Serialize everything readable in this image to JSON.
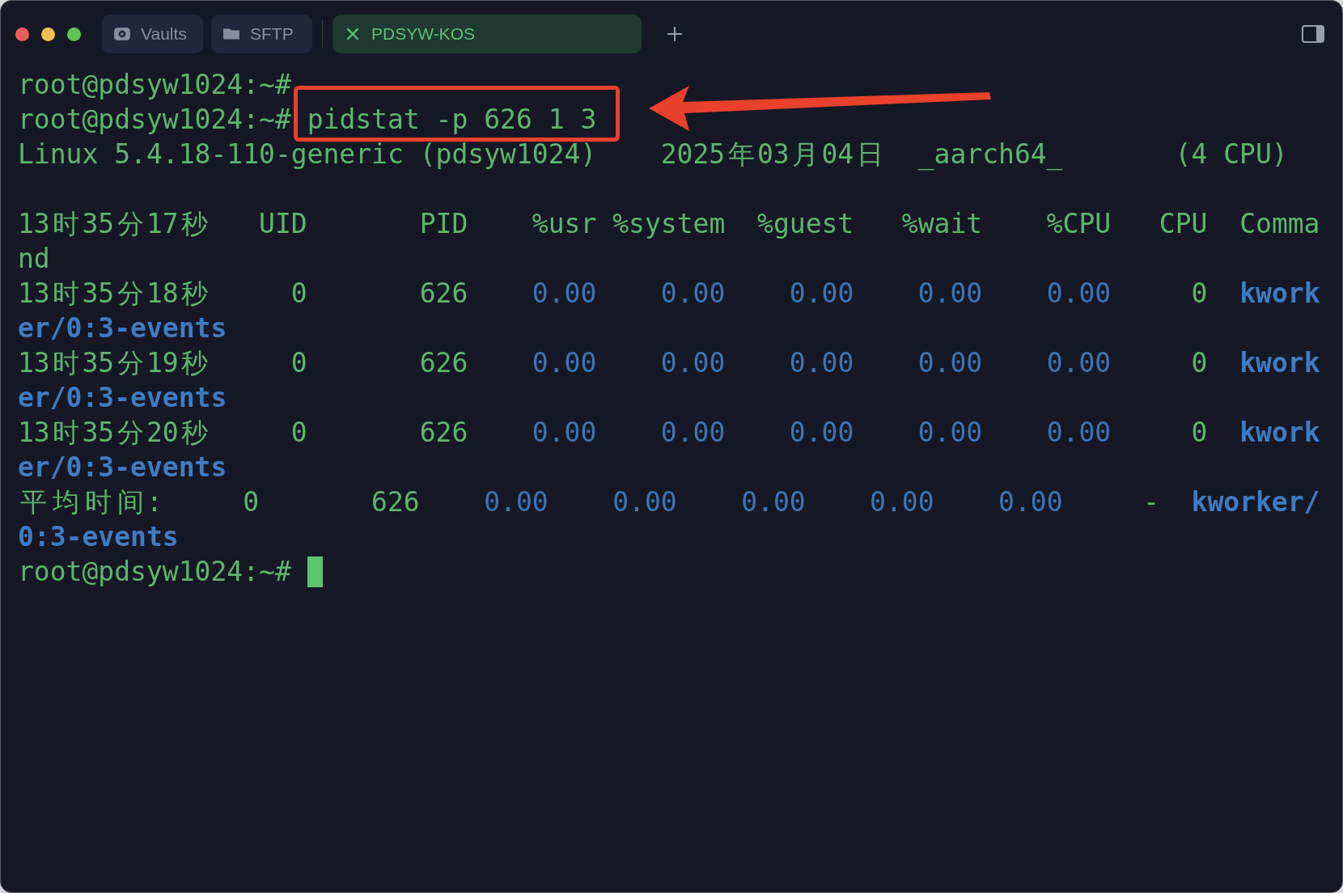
{
  "tabs": [
    {
      "label": "Vaults",
      "kind": "vault",
      "selected": false
    },
    {
      "label": "SFTP",
      "kind": "folder",
      "selected": false
    },
    {
      "label": "PDSYW-KOS",
      "kind": "session",
      "selected": true
    }
  ],
  "terminal": {
    "lines": [
      {
        "kind": "text",
        "segments": [
          {
            "text": "root@pdsyw1024:~#",
            "kind": "text"
          }
        ]
      },
      {
        "kind": "text",
        "segments": [
          {
            "text": "root@pdsyw1024:~#",
            "kind": "text"
          },
          {
            "text": " pidstat -p 626 1 3",
            "kind": "command"
          }
        ]
      },
      {
        "kind": "text",
        "segments": [
          {
            "text": "Linux 5.4.18-110-generic (pdsyw1024)",
            "kind": "text"
          },
          {
            "text": "    2025年03月04日",
            "kind": "text"
          },
          {
            "text": "  _aarch64_",
            "kind": "text"
          },
          {
            "text": "       (4 CPU)",
            "kind": "text"
          }
        ]
      },
      {
        "kind": "blank"
      },
      {
        "kind": "text",
        "segments": [
          {
            "text": "13时35分17秒",
            "kind": "text"
          },
          {
            "text": "   UID",
            "kind": "text"
          },
          {
            "text": "       PID",
            "kind": "text"
          },
          {
            "text": "    %usr",
            "kind": "text"
          },
          {
            "text": " %system",
            "kind": "text"
          },
          {
            "text": "  %guest",
            "kind": "text"
          },
          {
            "text": "   %wait",
            "kind": "text"
          },
          {
            "text": "    %CPU",
            "kind": "text"
          },
          {
            "text": "   CPU",
            "kind": "text"
          },
          {
            "text": "  Comma",
            "kind": "text"
          }
        ]
      },
      {
        "kind": "text",
        "segments": [
          {
            "text": "nd",
            "kind": "text"
          }
        ]
      },
      {
        "kind": "text",
        "segments": [
          {
            "text": "13时35分18秒",
            "kind": "text"
          },
          {
            "text": "     0",
            "kind": "text"
          },
          {
            "text": "       626",
            "kind": "text"
          },
          {
            "text": "    0.00",
            "kind": "number"
          },
          {
            "text": "    0.00",
            "kind": "number"
          },
          {
            "text": "    0.00",
            "kind": "number"
          },
          {
            "text": "    0.00",
            "kind": "number"
          },
          {
            "text": "    0.00",
            "kind": "number"
          },
          {
            "text": "     0",
            "kind": "text"
          },
          {
            "text": "  kwork",
            "kind": "process"
          }
        ]
      },
      {
        "kind": "text",
        "segments": [
          {
            "text": "er/0:3-events",
            "kind": "process"
          }
        ]
      },
      {
        "kind": "text",
        "segments": [
          {
            "text": "13时35分19秒",
            "kind": "text"
          },
          {
            "text": "     0",
            "kind": "text"
          },
          {
            "text": "       626",
            "kind": "text"
          },
          {
            "text": "    0.00",
            "kind": "number"
          },
          {
            "text": "    0.00",
            "kind": "number"
          },
          {
            "text": "    0.00",
            "kind": "number"
          },
          {
            "text": "    0.00",
            "kind": "number"
          },
          {
            "text": "    0.00",
            "kind": "number"
          },
          {
            "text": "     0",
            "kind": "text"
          },
          {
            "text": "  kwork",
            "kind": "process"
          }
        ]
      },
      {
        "kind": "text",
        "segments": [
          {
            "text": "er/0:3-events",
            "kind": "process"
          }
        ]
      },
      {
        "kind": "text",
        "segments": [
          {
            "text": "13时35分20秒",
            "kind": "text"
          },
          {
            "text": "     0",
            "kind": "text"
          },
          {
            "text": "       626",
            "kind": "text"
          },
          {
            "text": "    0.00",
            "kind": "number"
          },
          {
            "text": "    0.00",
            "kind": "number"
          },
          {
            "text": "    0.00",
            "kind": "number"
          },
          {
            "text": "    0.00",
            "kind": "number"
          },
          {
            "text": "    0.00",
            "kind": "number"
          },
          {
            "text": "     0",
            "kind": "text"
          },
          {
            "text": "  kwork",
            "kind": "process"
          }
        ]
      },
      {
        "kind": "text",
        "segments": [
          {
            "text": "er/0:3-events",
            "kind": "process"
          }
        ]
      },
      {
        "kind": "text",
        "segments": [
          {
            "text": "平均时间:",
            "kind": "text"
          },
          {
            "text": "     0",
            "kind": "text"
          },
          {
            "text": "       626",
            "kind": "text"
          },
          {
            "text": "    0.00",
            "kind": "number"
          },
          {
            "text": "    0.00",
            "kind": "number"
          },
          {
            "text": "    0.00",
            "kind": "number"
          },
          {
            "text": "    0.00",
            "kind": "number"
          },
          {
            "text": "    0.00",
            "kind": "number"
          },
          {
            "text": "     -",
            "kind": "text"
          },
          {
            "text": "  kworker/",
            "kind": "process"
          }
        ]
      },
      {
        "kind": "text",
        "segments": [
          {
            "text": "0:3-events",
            "kind": "process"
          }
        ]
      },
      {
        "kind": "text",
        "cursor": true,
        "segments": [
          {
            "text": "root@pdsyw1024:~#",
            "kind": "text"
          }
        ]
      }
    ]
  }
}
